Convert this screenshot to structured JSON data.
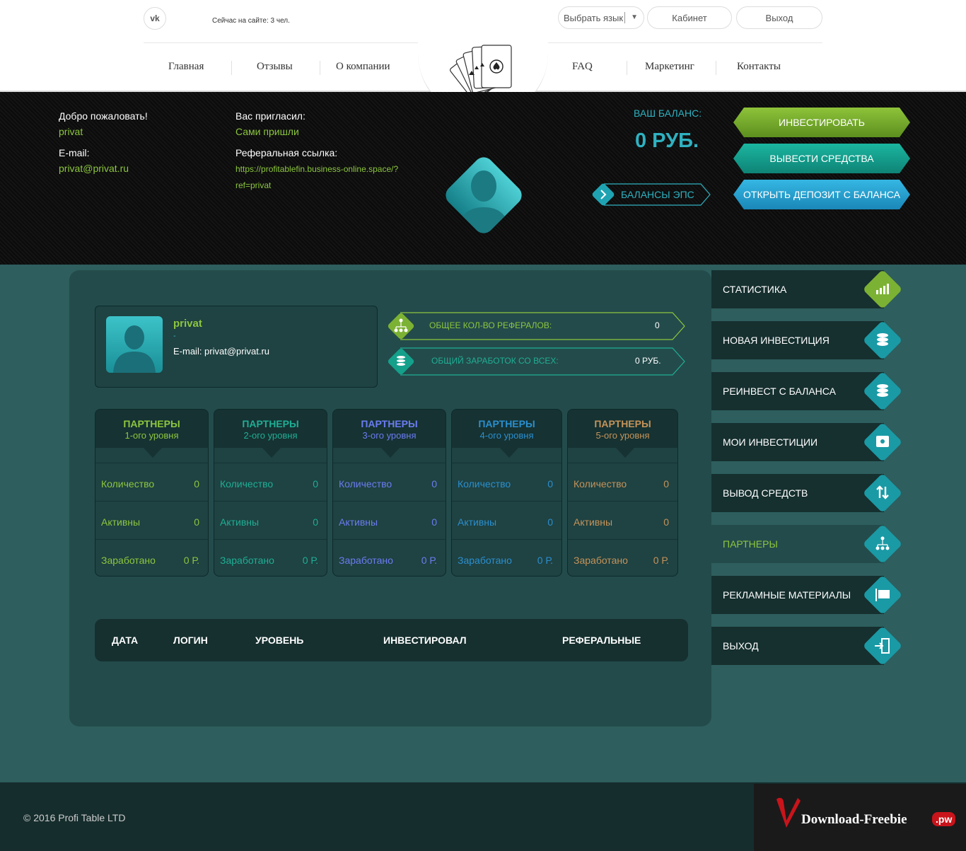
{
  "header": {
    "vk_label": "vk",
    "online_text": "Сейчас на сайте: 3 чел.",
    "lang_label": "Выбрать язык",
    "cabinet_label": "Кабинет",
    "exit_label": "Выход",
    "nav": [
      "Главная",
      "Отзывы",
      "О компании",
      "FAQ",
      "Маркетинг",
      "Контакты"
    ]
  },
  "user_band": {
    "welcome_label": "Добро пожаловать!",
    "login": "privat",
    "email_label": "E-mail:",
    "email": "privat@privat.ru",
    "invited_label": "Вас пригласил:",
    "invited_value": "Сами пришли",
    "ref_label": "Реферальная ссылка:",
    "ref_link_line1": "https://profitablefin.business-online.space/?",
    "ref_link_line2": "ref=privat",
    "balance_label": "ВАШ БАЛАНС:",
    "balance_value": "0 РУБ.",
    "eps_label": "БАЛАНСЫ ЭПС",
    "btn_invest": "ИНВЕСТИРОВАТЬ",
    "btn_withdraw": "ВЫВЕСТИ СРЕДСТВА",
    "btn_deposit": "ОТКРЫТЬ ДЕПОЗИТ С БАЛАНСА"
  },
  "profile": {
    "login": "privat",
    "dash": "-",
    "email_line": "E-mail: privat@privat.ru"
  },
  "stats": {
    "ref_count_label": "ОБЩЕЕ КОЛ-ВО РЕФЕРАЛОВ:",
    "ref_count_value": "0",
    "earnings_label": "ОБЩИЙ ЗАРАБОТОК СО ВСЕХ:",
    "earnings_value": "0 РУБ."
  },
  "levels": [
    {
      "title": "ПАРТНЕРЫ",
      "subtitle": "1-ого уровня",
      "count_label": "Количество",
      "count": "0",
      "active_label": "Активны",
      "active": "0",
      "earned_label": "Заработано",
      "earned": "0 Р.",
      "color": "#8cc63f"
    },
    {
      "title": "ПАРТНЕРЫ",
      "subtitle": "2-ого уровня",
      "count_label": "Количество",
      "count": "0",
      "active_label": "Активны",
      "active": "0",
      "earned_label": "Заработано",
      "earned": "0 Р.",
      "color": "#1fae95"
    },
    {
      "title": "ПАРТНЕРЫ",
      "subtitle": "3-ого уровня",
      "count_label": "Количество",
      "count": "0",
      "active_label": "Активны",
      "active": "0",
      "earned_label": "Заработано",
      "earned": "0 Р.",
      "color": "#6a7cf0"
    },
    {
      "title": "ПАРТНЕРЫ",
      "subtitle": "4-ого уровня",
      "count_label": "Количество",
      "count": "0",
      "active_label": "Активны",
      "active": "0",
      "earned_label": "Заработано",
      "earned": "0 Р.",
      "color": "#2a8fcf"
    },
    {
      "title": "ПАРТНЕРЫ",
      "subtitle": "5-ого уровня",
      "count_label": "Количество",
      "count": "0",
      "active_label": "Активны",
      "active": "0",
      "earned_label": "Заработано",
      "earned": "0 Р.",
      "color": "#c4935a"
    }
  ],
  "table": {
    "columns": [
      "ДАТА",
      "ЛОГИН",
      "УРОВЕНЬ",
      "ИНВЕСТИРОВАЛ",
      "РЕФЕРАЛЬНЫЕ"
    ]
  },
  "side_menu": [
    {
      "label": "СТАТИСТИКА",
      "icon": "bar-chart-icon",
      "active": false
    },
    {
      "label": "НОВАЯ ИНВЕСТИЦИЯ",
      "icon": "coins-icon",
      "active": false
    },
    {
      "label": "РЕИНВЕСТ С БАЛАНСА",
      "icon": "coins-icon",
      "active": false
    },
    {
      "label": "МОИ ИНВЕСТИЦИИ",
      "icon": "safe-icon",
      "active": false
    },
    {
      "label": "ВЫВОД СРЕДСТВ",
      "icon": "arrows-icon",
      "active": false
    },
    {
      "label": "ПАРТНЕРЫ",
      "icon": "network-icon",
      "active": true
    },
    {
      "label": "РЕКЛАМНЫЕ МАТЕРИАЛЫ",
      "icon": "banner-icon",
      "active": false
    },
    {
      "label": "ВЫХОД",
      "icon": "logout-icon",
      "active": false
    }
  ],
  "footer": {
    "copyright": "© 2016 Profi Table LTD",
    "watermark_text": "Download-Freebie",
    "watermark_tld": ".pw"
  },
  "colors": {
    "accent_green": "#8cc63f",
    "accent_teal": "#2fb1c0",
    "panel": "#244b4b",
    "background": "#2e5e5e"
  }
}
